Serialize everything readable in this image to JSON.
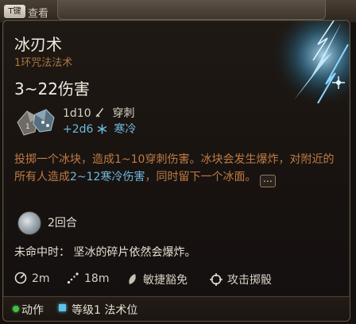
{
  "header": {
    "key_label": "T键",
    "action_label": "查看"
  },
  "spell": {
    "name": "冰刃术",
    "school_level": "1环咒法法术",
    "damage_range": "3~22伤害",
    "dice": [
      {
        "formula": "1d10",
        "type": "穿刺",
        "icon": "piercing-dagger-icon"
      },
      {
        "formula": "+2d6",
        "type": "寒冷",
        "icon": "snowflake-icon"
      }
    ],
    "description": {
      "part1": "投掷一个冰块，造成1~10穿刺伤害。冰块会发生爆炸，对附近的所有人造成",
      "highlight": "2~12寒冷伤害",
      "part2": "，同时留下一个冰面。"
    },
    "duration": "2回合",
    "on_miss": "未命中时：  坚冰的碎片依然会爆炸。",
    "stats": {
      "radius": "2m",
      "range": "18m",
      "save": "敏捷豁免",
      "attack": "攻击掷骰"
    }
  },
  "footer": {
    "action": "动作",
    "slot": "等级1 法术位"
  },
  "colors": {
    "accent_blue": "#6fb7df",
    "accent_orange": "#c07a45",
    "action_green": "#3fbf4a"
  }
}
